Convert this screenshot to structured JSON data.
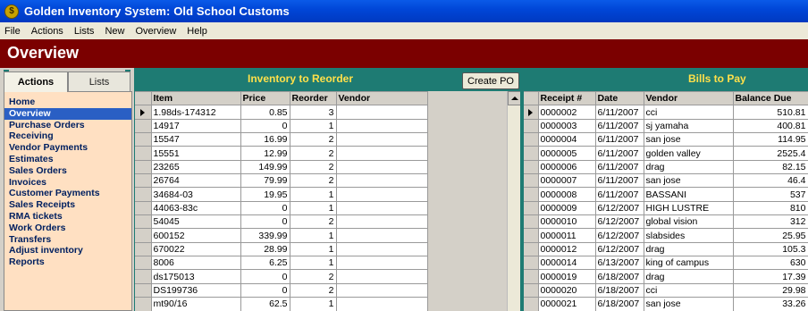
{
  "window": {
    "title": "Golden Inventory System: Old School Customs",
    "icon": "app-logo-icon"
  },
  "menu": [
    "File",
    "Actions",
    "Lists",
    "New",
    "Overview",
    "Help"
  ],
  "page_title": "Overview",
  "left_panel": {
    "tabs": [
      "Actions",
      "Lists"
    ],
    "active_tab": "Actions",
    "items": [
      "Home",
      "Overview",
      "Purchase Orders",
      "Receiving",
      "Vendor Payments",
      "Estimates",
      "Sales Orders",
      "Invoices",
      "Customer Payments",
      "Sales Receipts",
      "RMA tickets",
      "Work Orders",
      "Transfers",
      "Adjust inventory",
      "Reports"
    ],
    "selected": "Overview"
  },
  "inventory": {
    "title": "Inventory to Reorder",
    "create_po_label": "Create PO",
    "columns": [
      "Item",
      "Price",
      "Reorder",
      "Vendor"
    ],
    "rows": [
      [
        "1.98ds-174312",
        "0.85",
        "3",
        ""
      ],
      [
        "14917",
        "0",
        "1",
        ""
      ],
      [
        "15547",
        "16.99",
        "2",
        ""
      ],
      [
        "15551",
        "12.99",
        "2",
        ""
      ],
      [
        "23265",
        "149.99",
        "2",
        ""
      ],
      [
        "26764",
        "79.99",
        "2",
        ""
      ],
      [
        "34684-03",
        "19.95",
        "1",
        ""
      ],
      [
        "44063-83c",
        "0",
        "1",
        ""
      ],
      [
        "54045",
        "0",
        "2",
        ""
      ],
      [
        "600152",
        "339.99",
        "1",
        ""
      ],
      [
        "670022",
        "28.99",
        "1",
        ""
      ],
      [
        "8006",
        "6.25",
        "1",
        ""
      ],
      [
        "ds175013",
        "0",
        "2",
        ""
      ],
      [
        "DS199736",
        "0",
        "2",
        ""
      ],
      [
        "mt90/16",
        "62.5",
        "1",
        ""
      ]
    ]
  },
  "bills": {
    "title": "Bills to Pay",
    "columns": [
      "Receipt #",
      "Date",
      "Vendor",
      "Balance Due"
    ],
    "rows": [
      [
        "0000002",
        "6/11/2007",
        "cci",
        "510.81"
      ],
      [
        "0000003",
        "6/11/2007",
        "sj yamaha",
        "400.81"
      ],
      [
        "0000004",
        "6/11/2007",
        "san jose",
        "114.95"
      ],
      [
        "0000005",
        "6/11/2007",
        "golden valley",
        "2525.4"
      ],
      [
        "0000006",
        "6/11/2007",
        "drag",
        "82.15"
      ],
      [
        "0000007",
        "6/11/2007",
        "san jose",
        "46.4"
      ],
      [
        "0000008",
        "6/11/2007",
        "BASSANI",
        "537"
      ],
      [
        "0000009",
        "6/12/2007",
        "HIGH LUSTRE",
        "810"
      ],
      [
        "0000010",
        "6/12/2007",
        "global vision",
        "312"
      ],
      [
        "0000011",
        "6/12/2007",
        "slabsides",
        "25.95"
      ],
      [
        "0000012",
        "6/12/2007",
        "drag",
        "105.3"
      ],
      [
        "0000014",
        "6/13/2007",
        "king of campus",
        "630"
      ],
      [
        "0000019",
        "6/18/2007",
        "drag",
        "17.39"
      ],
      [
        "0000020",
        "6/18/2007",
        "cci",
        "29.98"
      ],
      [
        "0000021",
        "6/18/2007",
        "san jose",
        "33.26"
      ]
    ]
  },
  "colors": {
    "header_red": "#7b0000",
    "teal": "#1e7b73",
    "section_title": "#ffe04a",
    "nav_bg": "#ffe0c2",
    "selection": "#2a5fc4"
  }
}
